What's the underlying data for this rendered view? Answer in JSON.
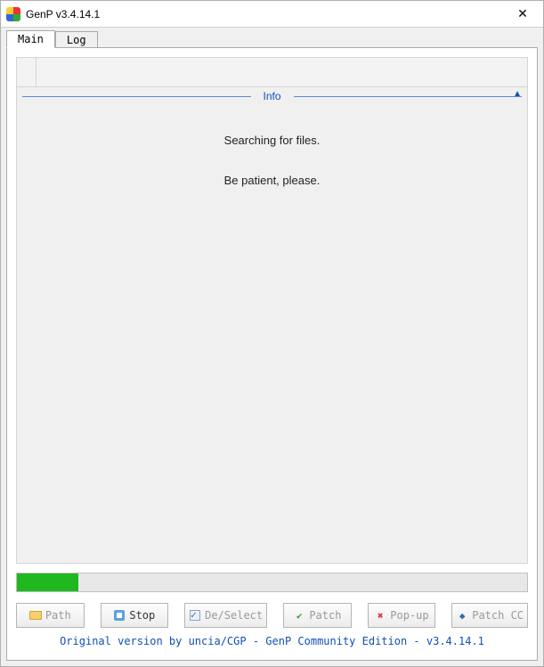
{
  "window": {
    "title": "GenP v3.4.14.1"
  },
  "tabs": {
    "main": "Main",
    "log": "Log",
    "active": "main"
  },
  "info": {
    "header": "Info",
    "line1": "Searching for files.",
    "line2": "Be patient, please."
  },
  "progress": {
    "percent": 12
  },
  "buttons": {
    "path": "Path",
    "stop": "Stop",
    "deselect": "De/Select",
    "patch": "Patch",
    "popup": "Pop-up",
    "patchcc": "Patch CC"
  },
  "footer": "Original version by uncia/CGP - GenP Community Edition - v3.4.14.1"
}
